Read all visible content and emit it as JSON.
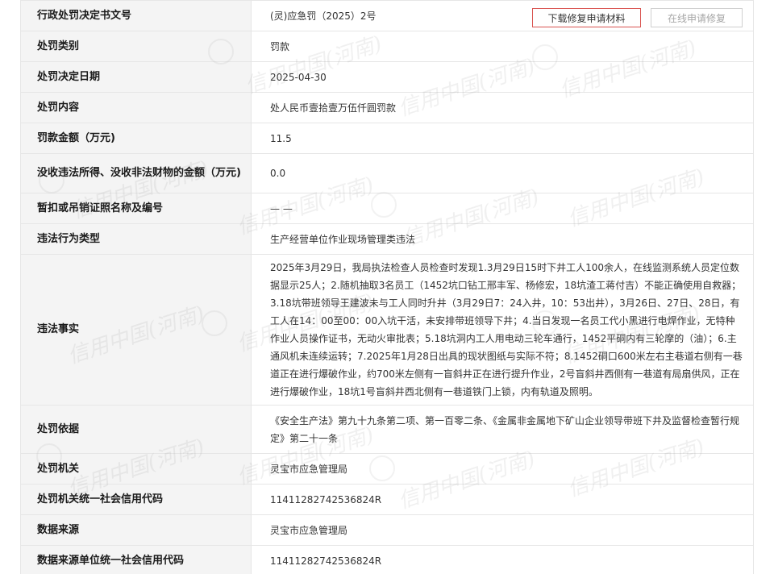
{
  "record": {
    "rows": [
      {
        "label": "行政处罚决定书文号",
        "value": "(灵)应急罚（2025）2号"
      },
      {
        "label": "处罚类别",
        "value": "罚款"
      },
      {
        "label": "处罚决定日期",
        "value": "2025-04-30"
      },
      {
        "label": "处罚内容",
        "value": "处人民币壹拾壹万伍仟圆罚款"
      },
      {
        "label": "罚款金额（万元)",
        "value": "11.5"
      },
      {
        "label": "没收违法所得、没收非法财物的金额（万元)",
        "value": "0.0"
      },
      {
        "label": "暂扣或吊销证照名称及编号",
        "value": "— —"
      },
      {
        "label": "违法行为类型",
        "value": "生产经营单位作业现场管理类违法"
      },
      {
        "label": "违法事实",
        "value": "2025年3月29日，我局执法检查人员检查时发现1.3月29日15时下井工人100余人，在线监测系统人员定位数据显示25人；2.随机抽取3名员工（1452坑口钻工邢丰军、杨修宏，18坑渣工蒋付吉）不能正确使用自救器；3.18坑带班领导王建波未与工人同时升井（3月29日7：24入井，10：53出井），3月26日、27日、28日，有工人在14：00至00：00入坑干活，未安排带班领导下井；4.当日发现一名员工代小黑进行电焊作业，无特种作业人员操作证书，无动火审批表；5.18坑洞内工人用电动三轮车通行，1452平硐内有三轮摩的（油）；6.主通风机未连续运转；7.2025年1月28日出具的现状图纸与实际不符；8.1452硐口600米左右主巷道右侧有一巷道正在进行爆破作业，约700米左侧有一盲斜井正在进行提升作业，2号盲斜井西侧有一巷道有局扇供风，正在进行爆破作业，18坑1号盲斜井西北侧有一巷道铁门上锁，内有轨道及照明。"
      },
      {
        "label": "处罚依据",
        "value": "《安全生产法》第九十九条第二项、第一百零二条、《金属非金属地下矿山企业领导带班下井及监督检查暂行规定》第二十一条"
      },
      {
        "label": "处罚机关",
        "value": "灵宝市应急管理局"
      },
      {
        "label": "处罚机关统一社会信用代码",
        "value": "11411282742536824R"
      },
      {
        "label": "数据来源",
        "value": "灵宝市应急管理局"
      },
      {
        "label": "数据来源单位统一社会信用代码",
        "value": "11411282742536824R"
      }
    ]
  },
  "actions": {
    "download_label": "下载修复申请材料",
    "online_label": "在线申请修复"
  },
  "watermark": {
    "text": "信用中国(河南)",
    "color": "#969696"
  }
}
